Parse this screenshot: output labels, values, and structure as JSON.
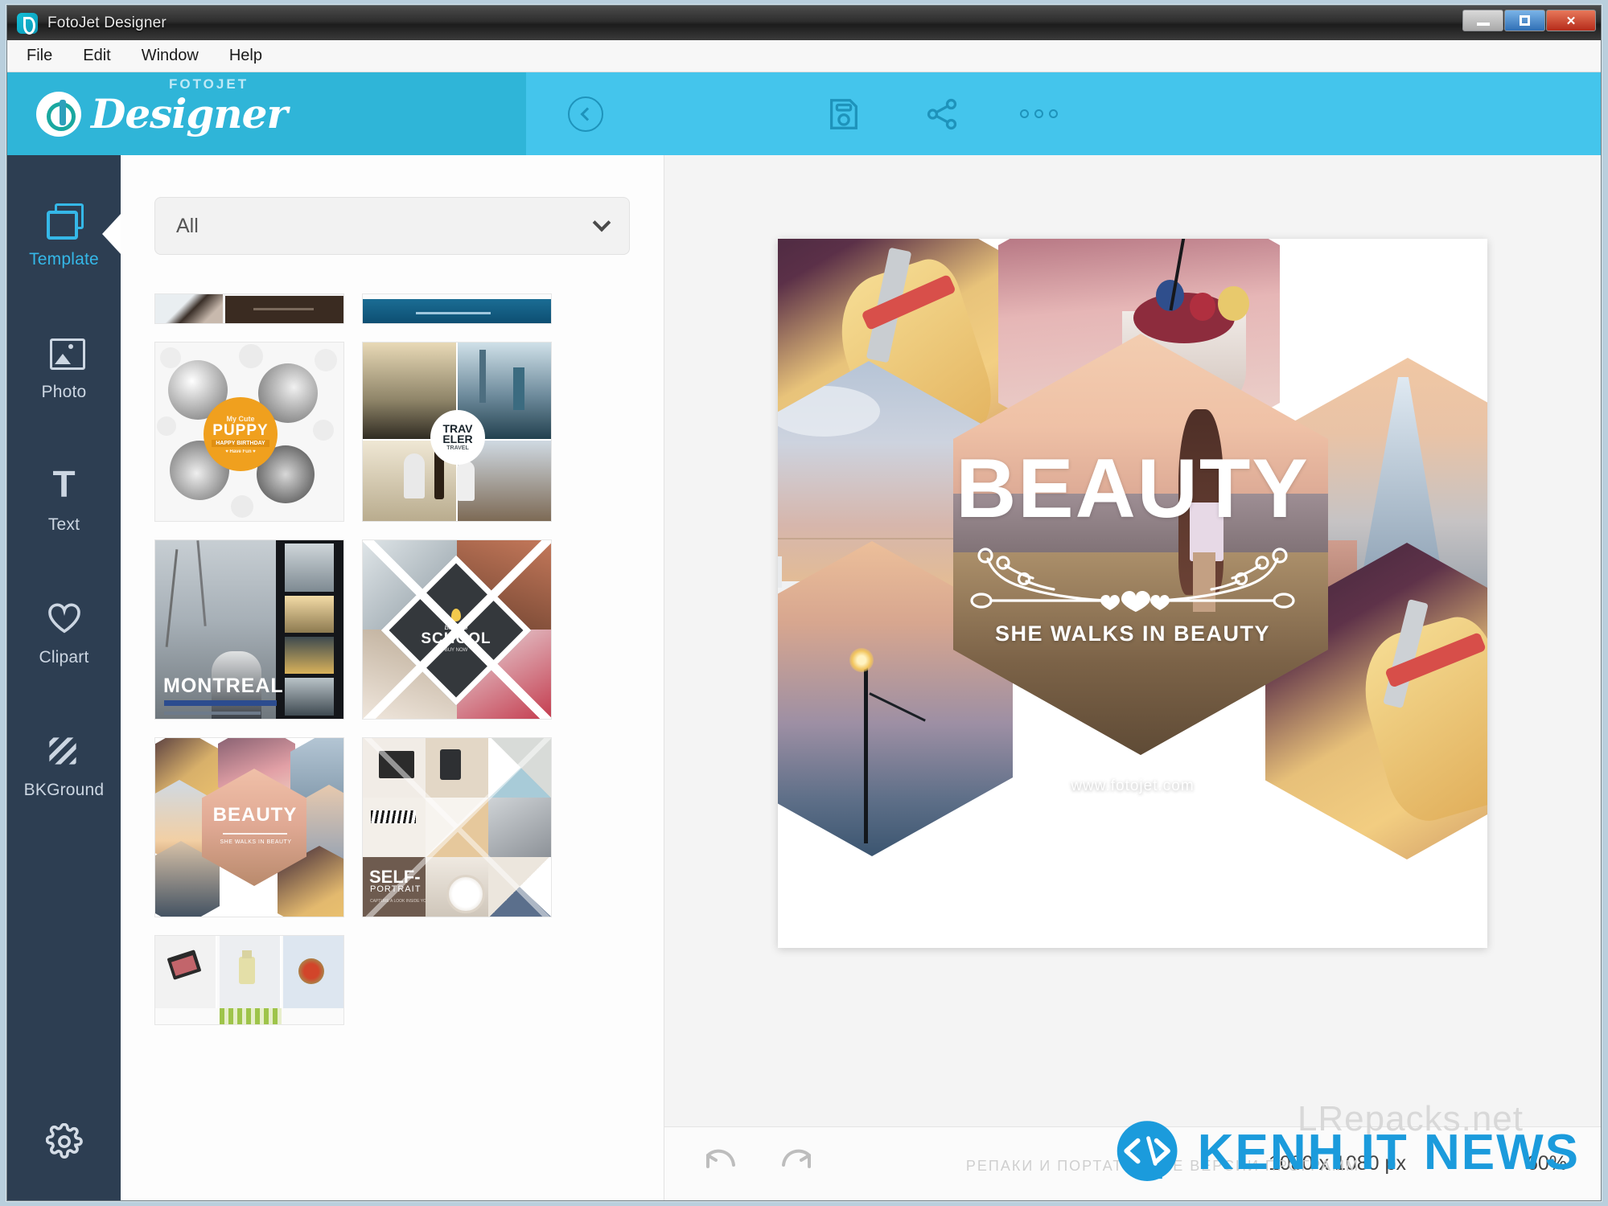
{
  "window": {
    "title": "FotoJet Designer",
    "controls": {
      "minimize": "–",
      "maximize": "□",
      "close": "✕"
    }
  },
  "menubar": {
    "items": [
      {
        "label": "File"
      },
      {
        "label": "Edit"
      },
      {
        "label": "Window"
      },
      {
        "label": "Help"
      }
    ]
  },
  "header": {
    "logo_top": "FOTOJET",
    "logo_main": "Designer",
    "accent_dark": "#2fb5d8",
    "accent_light": "#44c5ec",
    "tools": [
      {
        "name": "back",
        "label": "Back"
      },
      {
        "name": "save",
        "label": "Save"
      },
      {
        "name": "share",
        "label": "Share"
      },
      {
        "name": "more",
        "label": "More"
      }
    ]
  },
  "sidebar": {
    "background": "#2d3e52",
    "active_color": "#35b8e8",
    "items": [
      {
        "label": "Template",
        "icon": "template-icon",
        "active": true
      },
      {
        "label": "Photo",
        "icon": "photo-icon",
        "active": false
      },
      {
        "label": "Text",
        "icon": "text-icon",
        "active": false
      },
      {
        "label": "Clipart",
        "icon": "heart-icon",
        "active": false
      },
      {
        "label": "BKGround",
        "icon": "stripes-icon",
        "active": false
      }
    ],
    "settings": {
      "label": "Settings",
      "icon": "gear-icon"
    }
  },
  "template_panel": {
    "filter": {
      "value": "All",
      "placeholder": "All"
    },
    "thumbnails": [
      {
        "id": "row0-left",
        "name": "partial-template-dark",
        "title": ""
      },
      {
        "id": "row0-right",
        "name": "partial-template-blue",
        "title": ""
      },
      {
        "id": "puppy",
        "name": "puppy-template",
        "title": "PUPPY",
        "subtitle": "HAPPY BIRTHDAY"
      },
      {
        "id": "traveler",
        "name": "traveler-template",
        "title": "TRAV ELER",
        "subtitle": "TRAVEL"
      },
      {
        "id": "montreal",
        "name": "montreal-template",
        "title": "MONTREAL",
        "subtitle": ""
      },
      {
        "id": "school",
        "name": "back-to-school-template",
        "title": "SCHOOL",
        "subtitle": "Back To"
      },
      {
        "id": "beauty",
        "name": "beauty-template",
        "title": "BEAUTY",
        "subtitle": "SHE WALKS IN BEAUTY"
      },
      {
        "id": "self",
        "name": "self-template",
        "title": "SELF-",
        "subtitle": "PORTRAIT"
      },
      {
        "id": "cosmetics",
        "name": "cosmetics-template",
        "title": "",
        "subtitle": ""
      }
    ]
  },
  "canvas": {
    "design": {
      "title": "BEAUTY",
      "subtitle": "SHE WALKS IN BEAUTY",
      "url": "www.fotojet.com",
      "ornament": "floral-hearts-divider"
    },
    "cells": [
      {
        "name": "hex-top-left",
        "content": "pastry-photo"
      },
      {
        "name": "hex-top-right",
        "content": "berry-dessert-photo"
      },
      {
        "name": "hex-center",
        "content": "beach-sunset-woman-photo"
      },
      {
        "name": "hex-mid-left",
        "content": "harbor-sunset-photo"
      },
      {
        "name": "hex-mid-right",
        "content": "city-skyscraper-photo"
      },
      {
        "name": "hex-bottom-left",
        "content": "lamp-post-dusk-photo"
      },
      {
        "name": "hex-bottom-right",
        "content": "pastry-photo"
      }
    ]
  },
  "statusbar": {
    "undo": {
      "label": "Undo",
      "icon": "undo-icon"
    },
    "redo": {
      "label": "Redo",
      "icon": "redo-icon"
    },
    "dimensions": "1080 x 1080 px",
    "zoom": "60%"
  },
  "watermarks": {
    "lrepacks": "LRepacks.net",
    "ru_line": "РЕПАКИ И ПОРТАТИВНЫЕ ВЕРСИИ ПРОГРАММ",
    "kenh": "KENH IT NEWS"
  }
}
